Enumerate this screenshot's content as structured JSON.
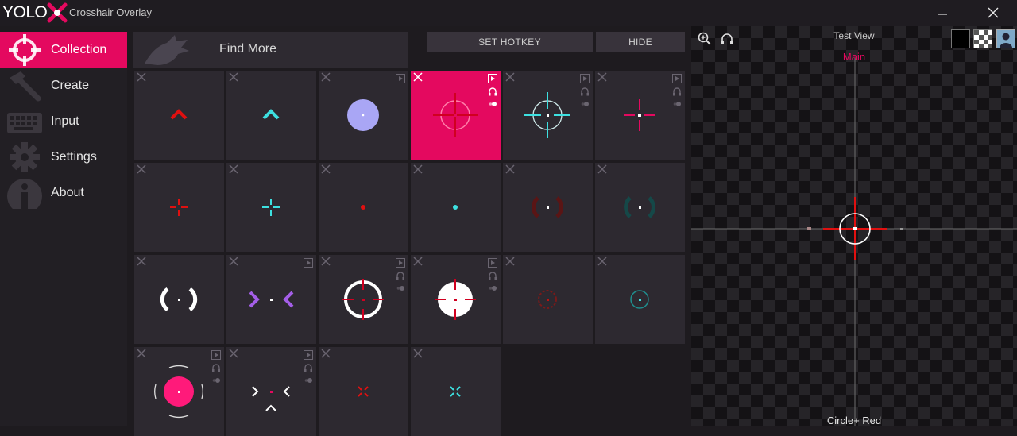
{
  "app": {
    "logo_text": "YOLO",
    "title": "Crosshair Overlay"
  },
  "sidebar": {
    "items": [
      {
        "label": "Collection",
        "icon": "crosshair-icon",
        "active": true
      },
      {
        "label": "Create",
        "icon": "hammer-icon"
      },
      {
        "label": "Input",
        "icon": "keyboard-icon"
      },
      {
        "label": "Settings",
        "icon": "gear-icon"
      },
      {
        "label": "About",
        "icon": "info-icon"
      }
    ]
  },
  "toolbar": {
    "find_more": "Find More",
    "set_hotkey": "SET HOTKEY",
    "hide": "HIDE"
  },
  "collection": {
    "selected_index": 3,
    "items": [
      {
        "type": "chevron-red-crosshair",
        "color": "#e01010",
        "has_play": false
      },
      {
        "type": "chevron-cyan-crosshair",
        "color": "#3de0e0",
        "has_play": false
      },
      {
        "type": "lavender-dot-crosshair",
        "color": "#a9a6f5",
        "has_play": true
      },
      {
        "type": "circle-plus-red-crosshair",
        "color": "#e01010",
        "has_play": true,
        "has_audio": true
      },
      {
        "type": "circle-plus-cyan-crosshair",
        "color": "#3de0e0",
        "has_play": true,
        "has_audio": true
      },
      {
        "type": "plus-pink-crosshair",
        "color": "#e4095f",
        "has_play": true,
        "has_audio": true
      },
      {
        "type": "small-plus-red-crosshair",
        "color": "#e01010"
      },
      {
        "type": "small-plus-cyan-crosshair",
        "color": "#3de0e0"
      },
      {
        "type": "dot-red-crosshair",
        "color": "#e01010"
      },
      {
        "type": "dot-cyan-crosshair",
        "color": "#3de0e0"
      },
      {
        "type": "brackets-darkred-crosshair",
        "color": "#5a1515"
      },
      {
        "type": "brackets-darkcyan-crosshair",
        "color": "#154848"
      },
      {
        "type": "brackets-white-crosshair",
        "color": "#ffffff"
      },
      {
        "type": "chevrons-purple-crosshair",
        "color": "#a45ee8",
        "has_play": true
      },
      {
        "type": "ring-white-red-crosshair",
        "color": "#ffffff",
        "has_play": true,
        "has_audio": true
      },
      {
        "type": "filled-white-red-crosshair",
        "color": "#ffffff",
        "has_play": true,
        "has_audio": true
      },
      {
        "type": "dashed-circle-darkred-crosshair",
        "color": "#5a1515"
      },
      {
        "type": "dashed-circle-cyan-crosshair",
        "color": "#2aa0a0"
      },
      {
        "type": "pink-target-crosshair",
        "color": "#ff1a7a",
        "has_play": true,
        "has_audio": true
      },
      {
        "type": "chevrons-white-crosshair",
        "color": "#ffffff",
        "has_play": true,
        "has_audio": true
      },
      {
        "type": "x-red-crosshair",
        "color": "#e01010"
      },
      {
        "type": "x-cyan-crosshair",
        "color": "#3de0e0"
      }
    ]
  },
  "preview": {
    "title": "Test View",
    "profile": "Main",
    "crosshair_name": "Circle+ Red",
    "background_options": [
      "black",
      "checker",
      "image"
    ]
  }
}
